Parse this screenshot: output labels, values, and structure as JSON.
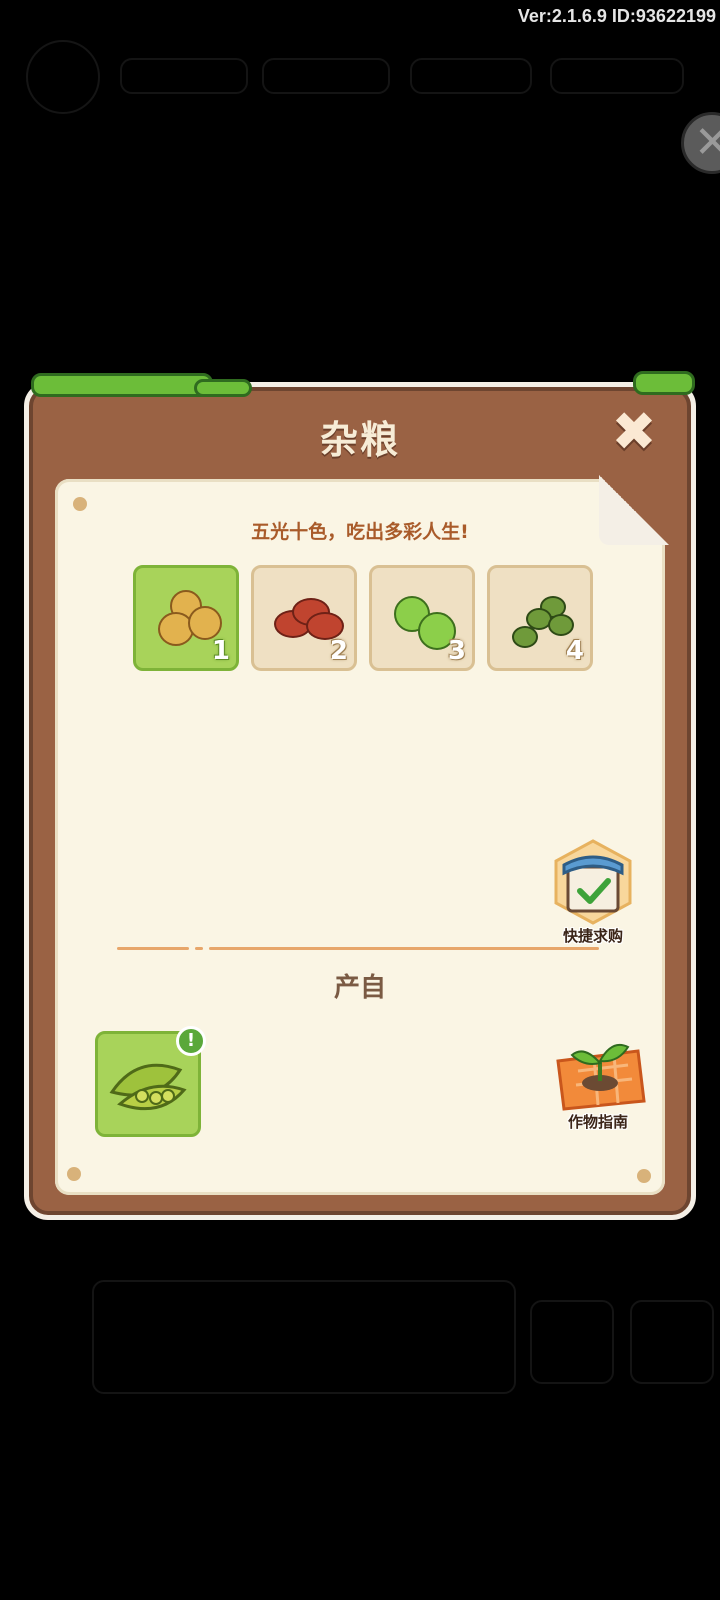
{
  "version_text": "Ver:2.1.6.9 ID:93622199",
  "top_close_icon": "close-icon",
  "panel": {
    "title": "杂粮",
    "close_icon": "close-icon",
    "slogan": "五光十色，吃出多彩人生!",
    "items": [
      {
        "num": "1",
        "icon": "soybean-icon",
        "selected": true
      },
      {
        "num": "2",
        "icon": "red-bean-icon",
        "selected": false
      },
      {
        "num": "3",
        "icon": "pea-icon",
        "selected": false
      },
      {
        "num": "4",
        "icon": "mung-bean-icon",
        "selected": false
      }
    ],
    "quick_buy_label": "快捷求购",
    "produce_label": "产自",
    "source_item": {
      "icon": "pea-pod-icon",
      "alert": "!"
    },
    "crop_guide_label": "作物指南"
  },
  "colors": {
    "panel_brown": "#9a6244",
    "paper": "#faf5e4",
    "selected_green": "#a8d35a",
    "slogan_orange": "#a95b2a"
  }
}
